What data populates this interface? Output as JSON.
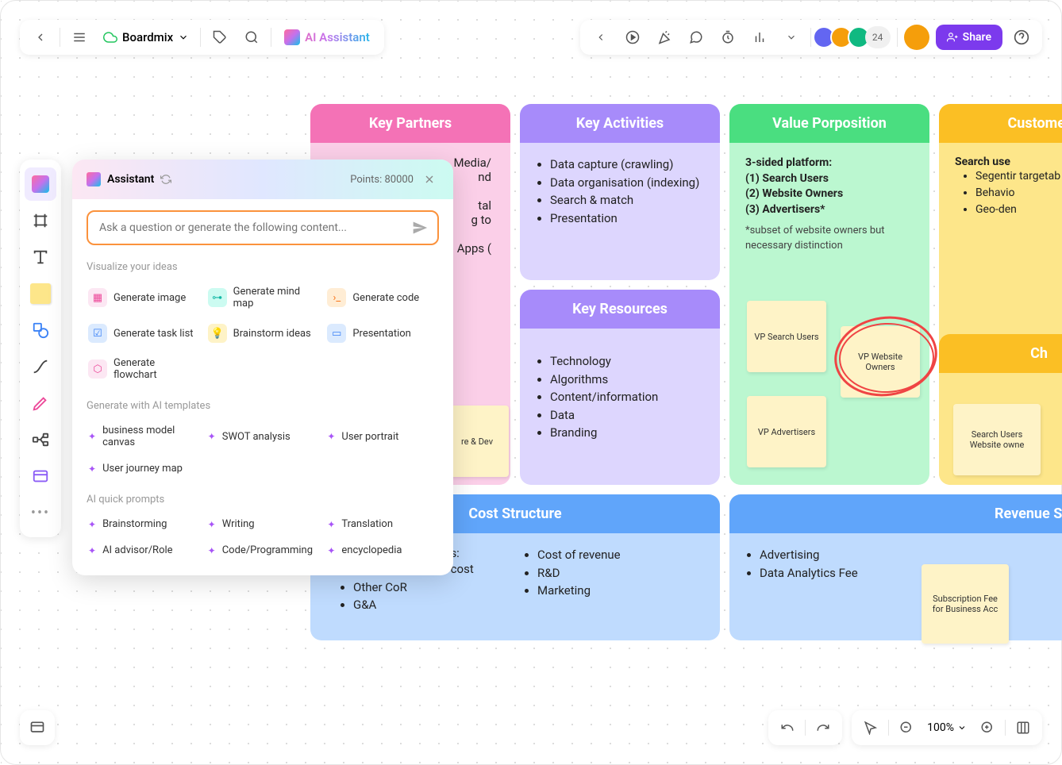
{
  "header": {
    "app_name": "Boardmix",
    "ai_btn": "AI Assistant",
    "avatar_count": "24",
    "share": "Share"
  },
  "zoom": "100%",
  "ai_panel": {
    "title": "Assistant",
    "points": "Points: 80000",
    "placeholder": "Ask a question or generate the following content...",
    "sections": {
      "visualize": {
        "title": "Visualize your ideas",
        "items": [
          "Generate image",
          "Generate mind map",
          "Generate code",
          "Generate task list",
          "Brainstorm ideas",
          "Presentation",
          "Generate flowchart"
        ]
      },
      "templates": {
        "title": "Generate with AI templates",
        "items": [
          "business model canvas",
          "SWOT analysis",
          "User portrait",
          "User journey map"
        ]
      },
      "prompts": {
        "title": "AI quick prompts",
        "items": [
          "Brainstorming",
          "Writing",
          "Translation",
          "AI advisor/Role",
          "Code/Programming",
          "encyclopedia"
        ]
      }
    }
  },
  "canvas": {
    "key_partners": {
      "title": "Key Partners",
      "body_line1": "Media/",
      "body_line2": "nd",
      "body_line3": "tal",
      "body_line4": "g to",
      "body_line5": "Apps (",
      "sticky": "re &\nDev"
    },
    "key_activities": {
      "title": "Key Activities",
      "items": [
        "Data capture (crawling)",
        "Data organisation (indexing)",
        "Search & match",
        "Presentation"
      ]
    },
    "key_resources": {
      "title": "Key Resources",
      "items": [
        "Technology",
        "Algorithms",
        "Content/information",
        "Data",
        "Branding"
      ]
    },
    "value_prop": {
      "title": "Value Porposition",
      "heading": "3-sided platform:",
      "line1": "(1) Search Users",
      "line2": "(2) Website Owners",
      "line3": "(3) Advertisers*",
      "note": "*subset of website owners but necessary distinction",
      "sticky1": "VP Search Users",
      "sticky2": "VP Website Owners",
      "sticky3": "VP Advertisers"
    },
    "customer": {
      "title": "Customer",
      "heading": "Search use",
      "items": [
        "Segentir targetab advertis",
        "Behavio",
        "Geo-den"
      ],
      "sticky": "Search Users\nWebsite owne"
    },
    "channels": {
      "title": "Ch"
    },
    "cost": {
      "title": "Cost Structure",
      "col1_heading": "Cost of revenue includes:",
      "col1_items": [
        "Traffic acquisition cost",
        "Other CoR",
        "G&A"
      ],
      "col2_items": [
        "Cost of revenue",
        "R&D",
        "Marketing"
      ]
    },
    "revenue": {
      "title": "Revenue Streams",
      "items": [
        "Advertising",
        "Data Analytics Fee"
      ],
      "sticky": "Subscription Fee for Business Acc"
    }
  }
}
